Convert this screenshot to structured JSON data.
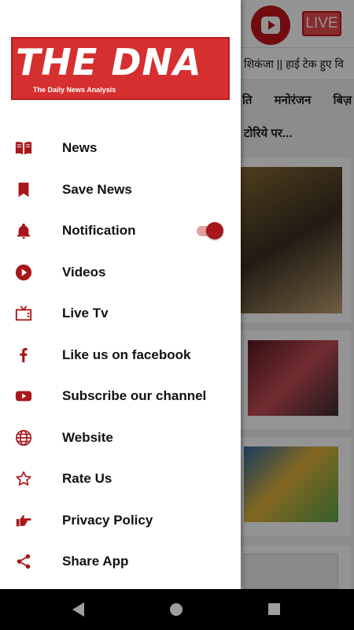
{
  "background": {
    "live_label": "LIVE",
    "ticker_text": "शिकंजा || हाई टेक हुए वि",
    "categories": [
      "ति",
      "मनोरंजन",
      "बिज़"
    ],
    "headline_fragment": "टोरिये पर..."
  },
  "drawer": {
    "logo": {
      "title": "THE DNA",
      "subtitle": "The Daily News Analysis",
      "brand_color": "#d62f2f"
    },
    "accent_color": "#a8171b",
    "menu": [
      {
        "label": "News",
        "icon": "book-open-icon"
      },
      {
        "label": "Save News",
        "icon": "bookmark-icon"
      },
      {
        "label": "Notification",
        "icon": "bell-icon",
        "toggle": true
      },
      {
        "label": "Videos",
        "icon": "play-circle-icon"
      },
      {
        "label": "Live Tv",
        "icon": "tv-icon"
      },
      {
        "label": "Like us on facebook",
        "icon": "facebook-icon"
      },
      {
        "label": "Subscribe our channel",
        "icon": "youtube-icon"
      },
      {
        "label": "Website",
        "icon": "globe-icon"
      },
      {
        "label": "Rate Us",
        "icon": "star-outline-icon"
      },
      {
        "label": "Privacy Policy",
        "icon": "hand-point-icon"
      },
      {
        "label": "Share App",
        "icon": "share-icon"
      }
    ]
  }
}
